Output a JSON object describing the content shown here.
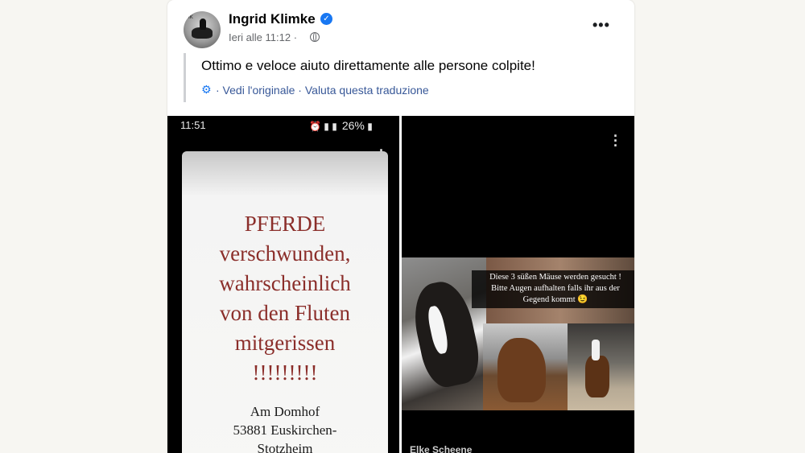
{
  "post": {
    "author": "Ingrid Klimke",
    "timestamp": "Ieri alle 11:12 ·",
    "audience_icon": "globe-icon",
    "more_icon": "more-options-icon",
    "text": "Ottimo e veloce aiuto direttamente alle persone colpite!",
    "translation": {
      "gear_icon": "settings-icon",
      "see_original": " · Vedi l'originale",
      "separator": " · ",
      "rate_translation": "Valuta questa traduzione"
    },
    "accent_color": "#1877f2"
  },
  "left_image": {
    "status_time": "11:51",
    "status_battery": "26%",
    "flyer_lines": [
      "PFERDE",
      "verschwunden,",
      "wahrscheinlich",
      "von den Fluten",
      "mitgerissen",
      "!!!!!!!!!"
    ],
    "address_lines": [
      "Am Domhof",
      "53881 Euskirchen-",
      "Stotzheim"
    ]
  },
  "right_image": {
    "caption_line1": "Diese 3 süßen Mäuse werden gesucht !",
    "caption_line2": "Bitte Augen aufhalten falls ihr aus der",
    "caption_line3": "Gegend kommt 😉",
    "story_name": "Elke Scheene"
  }
}
